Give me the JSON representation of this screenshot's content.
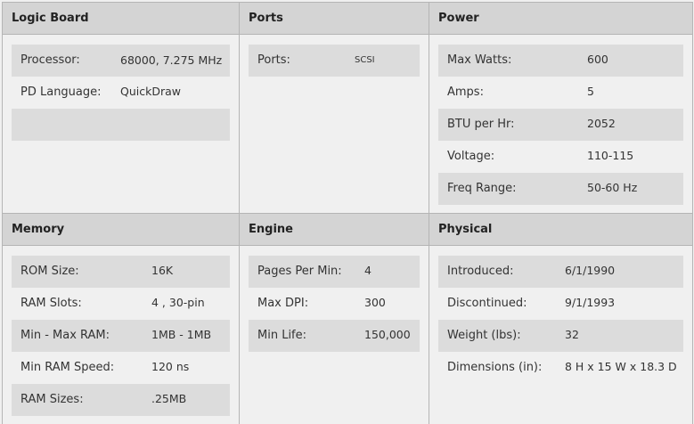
{
  "panels": {
    "logic_board": {
      "title": "Logic Board",
      "rows": [
        {
          "label": "Processor:",
          "value": "68000, 7.275 MHz"
        },
        {
          "label": "PD Language:",
          "value": "QuickDraw"
        },
        {
          "label": "",
          "value": ""
        }
      ]
    },
    "ports": {
      "title": "Ports",
      "rows": [
        {
          "label": "Ports:",
          "value": "SCSI"
        }
      ]
    },
    "power": {
      "title": "Power",
      "rows": [
        {
          "label": "Max Watts:",
          "value": "600"
        },
        {
          "label": "Amps:",
          "value": "5"
        },
        {
          "label": "BTU per Hr:",
          "value": "2052"
        },
        {
          "label": "Voltage:",
          "value": "110-115"
        },
        {
          "label": "Freq Range:",
          "value": "50-60 Hz"
        }
      ]
    },
    "memory": {
      "title": "Memory",
      "rows": [
        {
          "label": "ROM Size:",
          "value": "16K"
        },
        {
          "label": "RAM Slots:",
          "value": "4 , 30-pin"
        },
        {
          "label": "Min - Max RAM:",
          "value": "1MB - 1MB"
        },
        {
          "label": "Min RAM Speed:",
          "value": "120 ns"
        },
        {
          "label": "RAM Sizes:",
          "value": ".25MB"
        }
      ]
    },
    "engine": {
      "title": "Engine",
      "rows": [
        {
          "label": "Pages Per Min:",
          "value": "4"
        },
        {
          "label": "Max DPI:",
          "value": "300"
        },
        {
          "label": "Min Life:",
          "value": "150,000"
        }
      ]
    },
    "physical": {
      "title": "Physical",
      "rows": [
        {
          "label": "Introduced:",
          "value": "6/1/1990"
        },
        {
          "label": "Discontinued:",
          "value": "9/1/1993"
        },
        {
          "label": "Weight (lbs):",
          "value": "32"
        },
        {
          "label": "Dimensions (in):",
          "value": "8 H x 15 W x 18.3 D"
        }
      ]
    }
  }
}
